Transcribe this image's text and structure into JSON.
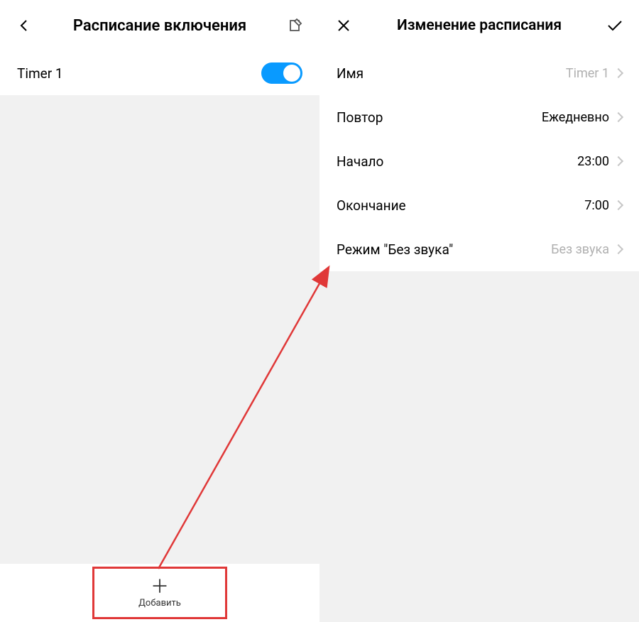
{
  "left": {
    "title": "Расписание включения",
    "timer": {
      "label": "Timer 1",
      "enabled": true
    },
    "addLabel": "Добавить"
  },
  "right": {
    "title": "Изменение расписания",
    "rows": {
      "name": {
        "label": "Имя",
        "value": "Timer 1"
      },
      "repeat": {
        "label": "Повтор",
        "value": "Ежедневно"
      },
      "start": {
        "label": "Начало",
        "value": "23:00"
      },
      "end": {
        "label": "Окончание",
        "value": "7:00"
      },
      "silent": {
        "label": "Режим \"Без звука\"",
        "value": "Без звука"
      }
    }
  }
}
